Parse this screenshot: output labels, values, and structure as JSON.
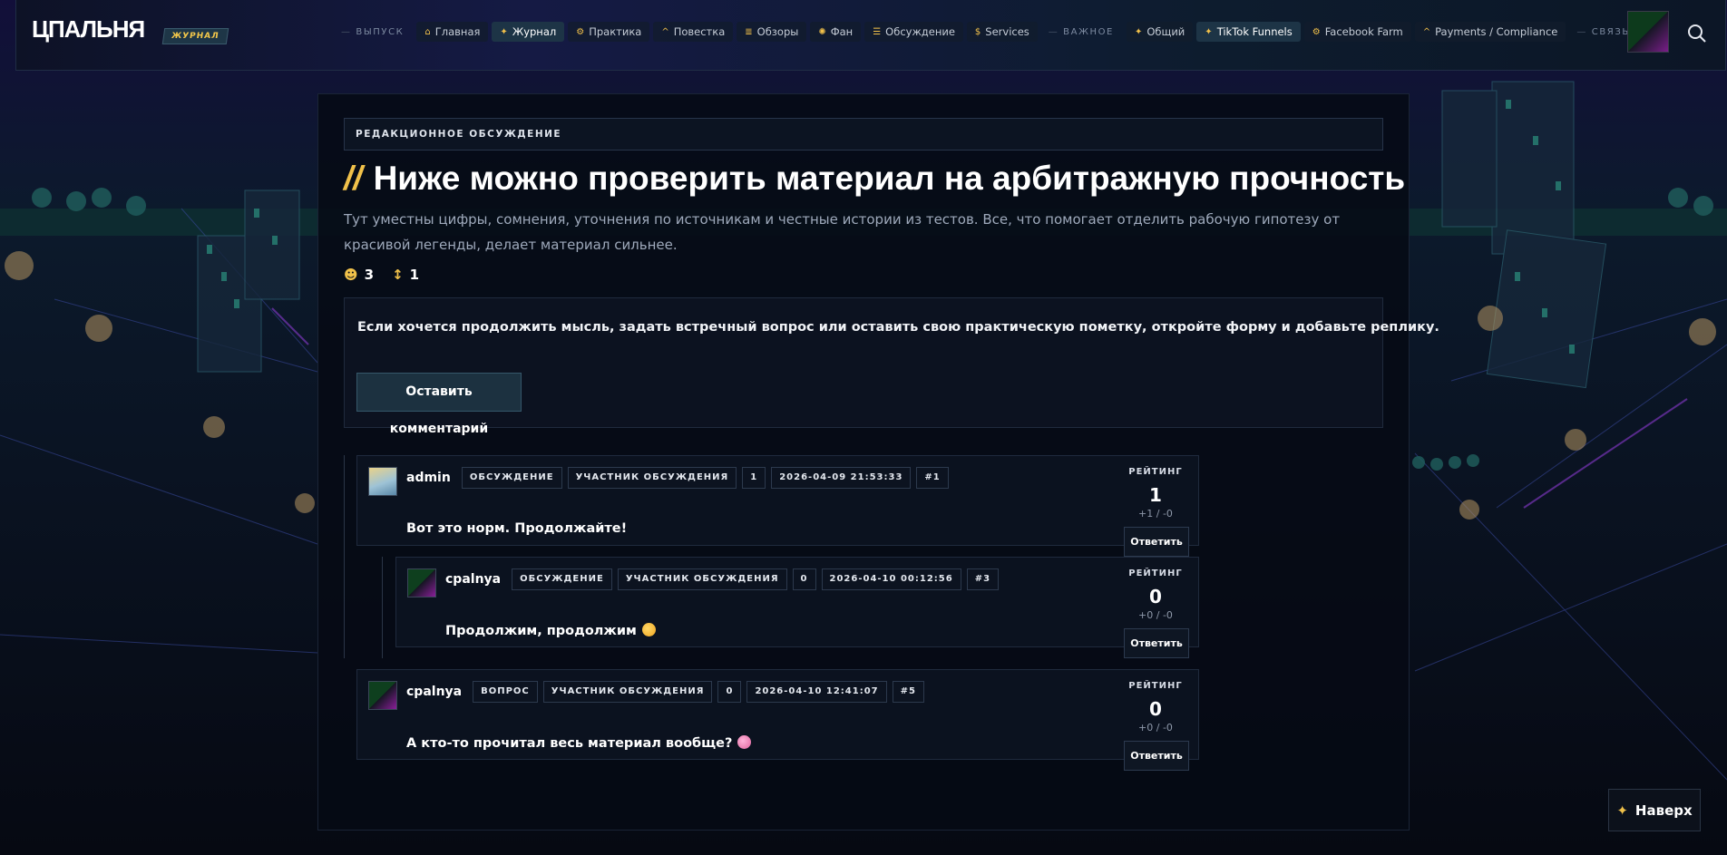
{
  "brand": {
    "logo": "ЦПАЛЬНЯ",
    "badge": "ЖУРНАЛ"
  },
  "nav": {
    "sections": {
      "release": "ВЫПУСК",
      "important": "ВАЖНОЕ",
      "contact": "СВЯЗЬ"
    },
    "items": [
      {
        "label": "Главная",
        "icon": "home-icon",
        "glyph": "⌂",
        "active": false
      },
      {
        "label": "Журнал",
        "icon": "spark-icon",
        "glyph": "✦",
        "active": true
      },
      {
        "label": "Практика",
        "icon": "gear-icon",
        "glyph": "⚙",
        "active": false
      },
      {
        "label": "Повестка",
        "icon": "caret-icon",
        "glyph": "^",
        "active": false
      },
      {
        "label": "Обзоры",
        "icon": "list-icon",
        "glyph": "≣",
        "active": false
      },
      {
        "label": "Фан",
        "icon": "sun-icon",
        "glyph": "✺",
        "active": false
      },
      {
        "label": "Обсуждение",
        "icon": "menu-icon",
        "glyph": "☰",
        "active": false
      },
      {
        "label": "Services",
        "icon": "dollar-icon",
        "glyph": "$",
        "active": false
      },
      {
        "label": "Общий",
        "icon": "spark-icon",
        "glyph": "✦",
        "active": false
      },
      {
        "label": "TikTok Funnels",
        "icon": "spark-icon",
        "glyph": "✦",
        "active": true
      },
      {
        "label": "Facebook Farm",
        "icon": "gear-icon",
        "glyph": "⚙",
        "active": false
      },
      {
        "label": "Payments / Compliance",
        "icon": "caret-icon",
        "glyph": "^",
        "active": false
      }
    ],
    "contact_glyph": "✉"
  },
  "article": {
    "kicker": "РЕДАКЦИОННОЕ ОБСУЖДЕНИЕ",
    "title_mark": "//",
    "title": "Ниже можно проверить материал на арбитражную прочность",
    "description": "Тут уместны цифры, сомнения, уточнения по источникам и честные истории из тестов. Все, что помогает отделить рабочую гипотезу от красивой легенды, делает материал сильнее.",
    "stats": {
      "comments": "3",
      "comments_icon": "bubble-icon",
      "sort": "1",
      "sort_icon": "sort-arrows-icon"
    }
  },
  "cta": {
    "text": "Если хочется продолжить мысль, задать встречный вопрос или оставить свою практическую пометку, откройте форму и добавьте реплику.",
    "button": "Оставить комментарий"
  },
  "rating_label": "РЕЙТИНГ",
  "reply_label": "Ответить",
  "comments": [
    {
      "author": "admin",
      "type": "ОБСУЖДЕНИЕ",
      "role": "УЧАСТНИК ОБСУЖДЕНИЯ",
      "count": "1",
      "date": "2026-04-09 21:53:33",
      "id": "#1",
      "body": "Вот это норм. Продолжайте!",
      "emoji": "",
      "rating": "1",
      "votes": "+1 / -0"
    },
    {
      "author": "cpalnya",
      "type": "ОБСУЖДЕНИЕ",
      "role": "УЧАСТНИК ОБСУЖДЕНИЯ",
      "count": "0",
      "date": "2026-04-10 00:12:56",
      "id": "#3",
      "body": "Продолжим, продолжим",
      "emoji": "smile-emoji",
      "rating": "0",
      "votes": "+0 / -0"
    },
    {
      "author": "cpalnya",
      "type": "ВОПРОС",
      "role": "УЧАСТНИК ОБСУЖДЕНИЯ",
      "count": "0",
      "date": "2026-04-10 12:41:07",
      "id": "#5",
      "body": "А кто-то прочитал весь материал вообще?",
      "emoji": "brain-emoji",
      "rating": "0",
      "votes": "+0 / -0"
    }
  ],
  "back_to_top": "Наверх",
  "colors": {
    "accent": "#f0c14a",
    "background": "#070b14",
    "panel": "#0d1321",
    "border": "#1f2a3d"
  }
}
